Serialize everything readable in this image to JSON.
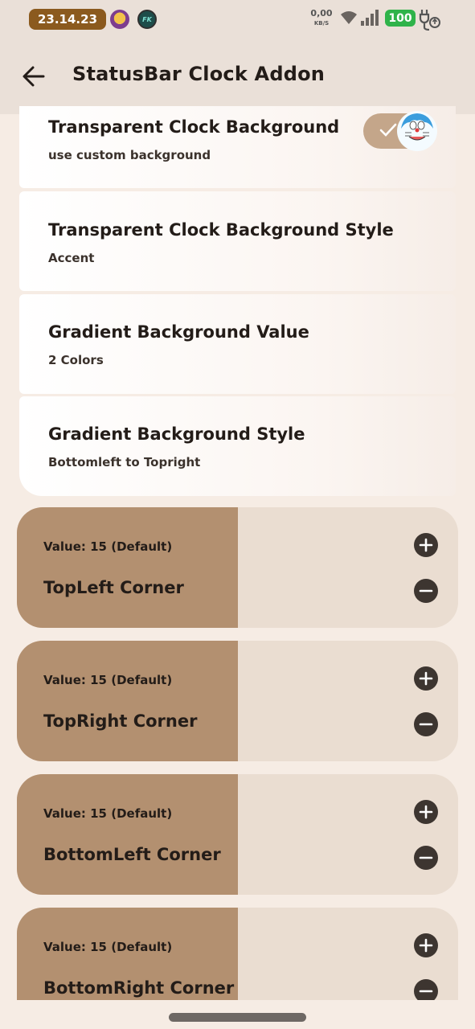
{
  "status_bar": {
    "time": "23.14.23",
    "net_speed": "0,00",
    "net_unit": "KB/S",
    "battery": "100",
    "avatar2_label": "FK",
    "icons": [
      "avatar-icon",
      "fk-app-icon",
      "wifi-icon",
      "signal-icon",
      "charging-icon"
    ]
  },
  "appbar": {
    "title": "StatusBar Clock Addon",
    "back_icon": "arrow-back-icon"
  },
  "preferences": [
    {
      "title": "Transparent Clock Background",
      "summary": "use custom background",
      "toggle": true
    },
    {
      "title": "Transparent Clock Background Style",
      "summary": "Accent"
    },
    {
      "title": "Gradient Background Value",
      "summary": "2 Colors"
    },
    {
      "title": "Gradient Background Style",
      "summary": "Bottomleft to Topright"
    }
  ],
  "sliders": [
    {
      "value_text": "Value: 15 (Default)",
      "label": "TopLeft Corner",
      "fill_fraction": 0.5
    },
    {
      "value_text": "Value: 15 (Default)",
      "label": "TopRight Corner",
      "fill_fraction": 0.5
    },
    {
      "value_text": "Value: 15 (Default)",
      "label": "BottomLeft Corner",
      "fill_fraction": 0.5
    },
    {
      "value_text": "Value: 15 (Default)",
      "label": "BottomRight Corner",
      "fill_fraction": 0.5
    }
  ],
  "colors": {
    "accent": "#b39070",
    "track": "#eaddd1",
    "toggle_on": "#c4a68a",
    "battery": "#2fb34a"
  }
}
